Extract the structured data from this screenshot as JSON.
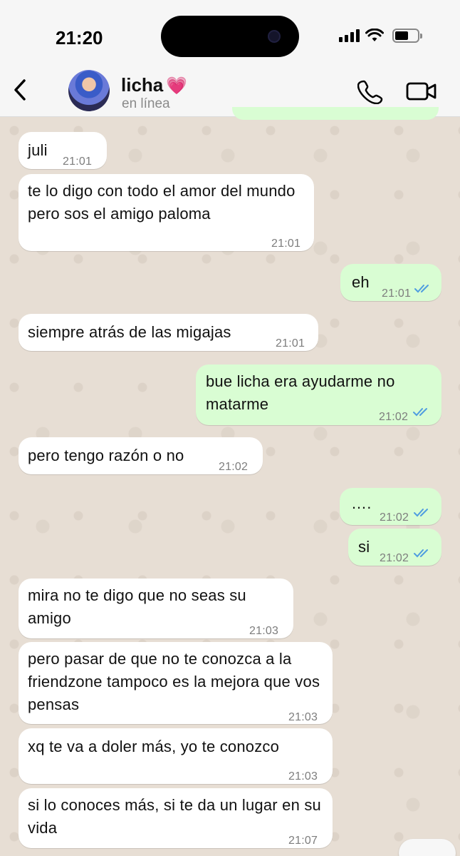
{
  "status": {
    "time": "21:20"
  },
  "contact": {
    "name": "licha",
    "emoji": "💗",
    "status": "en línea"
  },
  "messages": [
    {
      "dir": "in",
      "text": "juli",
      "time": "21:01"
    },
    {
      "dir": "in",
      "text": "te lo digo con todo el amor del mundo pero sos el amigo paloma",
      "time": "21:01"
    },
    {
      "dir": "out",
      "text": "eh",
      "time": "21:01",
      "read": true
    },
    {
      "dir": "in",
      "text": "siempre atrás de las migajas",
      "time": "21:01"
    },
    {
      "dir": "out",
      "text": "bue licha era ayudarme no matarme",
      "time": "21:02",
      "read": true
    },
    {
      "dir": "in",
      "text": "pero tengo razón o no",
      "time": "21:02"
    },
    {
      "dir": "out",
      "text": "….",
      "time": "21:02",
      "read": true
    },
    {
      "dir": "out",
      "text": "si",
      "time": "21:02",
      "read": true
    },
    {
      "dir": "in",
      "text": "mira no te digo que no seas su amigo",
      "time": "21:03"
    },
    {
      "dir": "in",
      "text": "pero pasar de que no te conozca a la friendzone tampoco es la mejora que vos pensas",
      "time": "21:03"
    },
    {
      "dir": "in",
      "text": "xq te va a doler más, yo te conozco",
      "time": "21:03"
    },
    {
      "dir": "in",
      "text": "si lo conoces más, si te da un lugar en su vida",
      "time": "21:07"
    }
  ],
  "colors": {
    "outgoing": "#d9fdd3",
    "incoming": "#ffffff",
    "read_ticks": "#4f9de0"
  }
}
